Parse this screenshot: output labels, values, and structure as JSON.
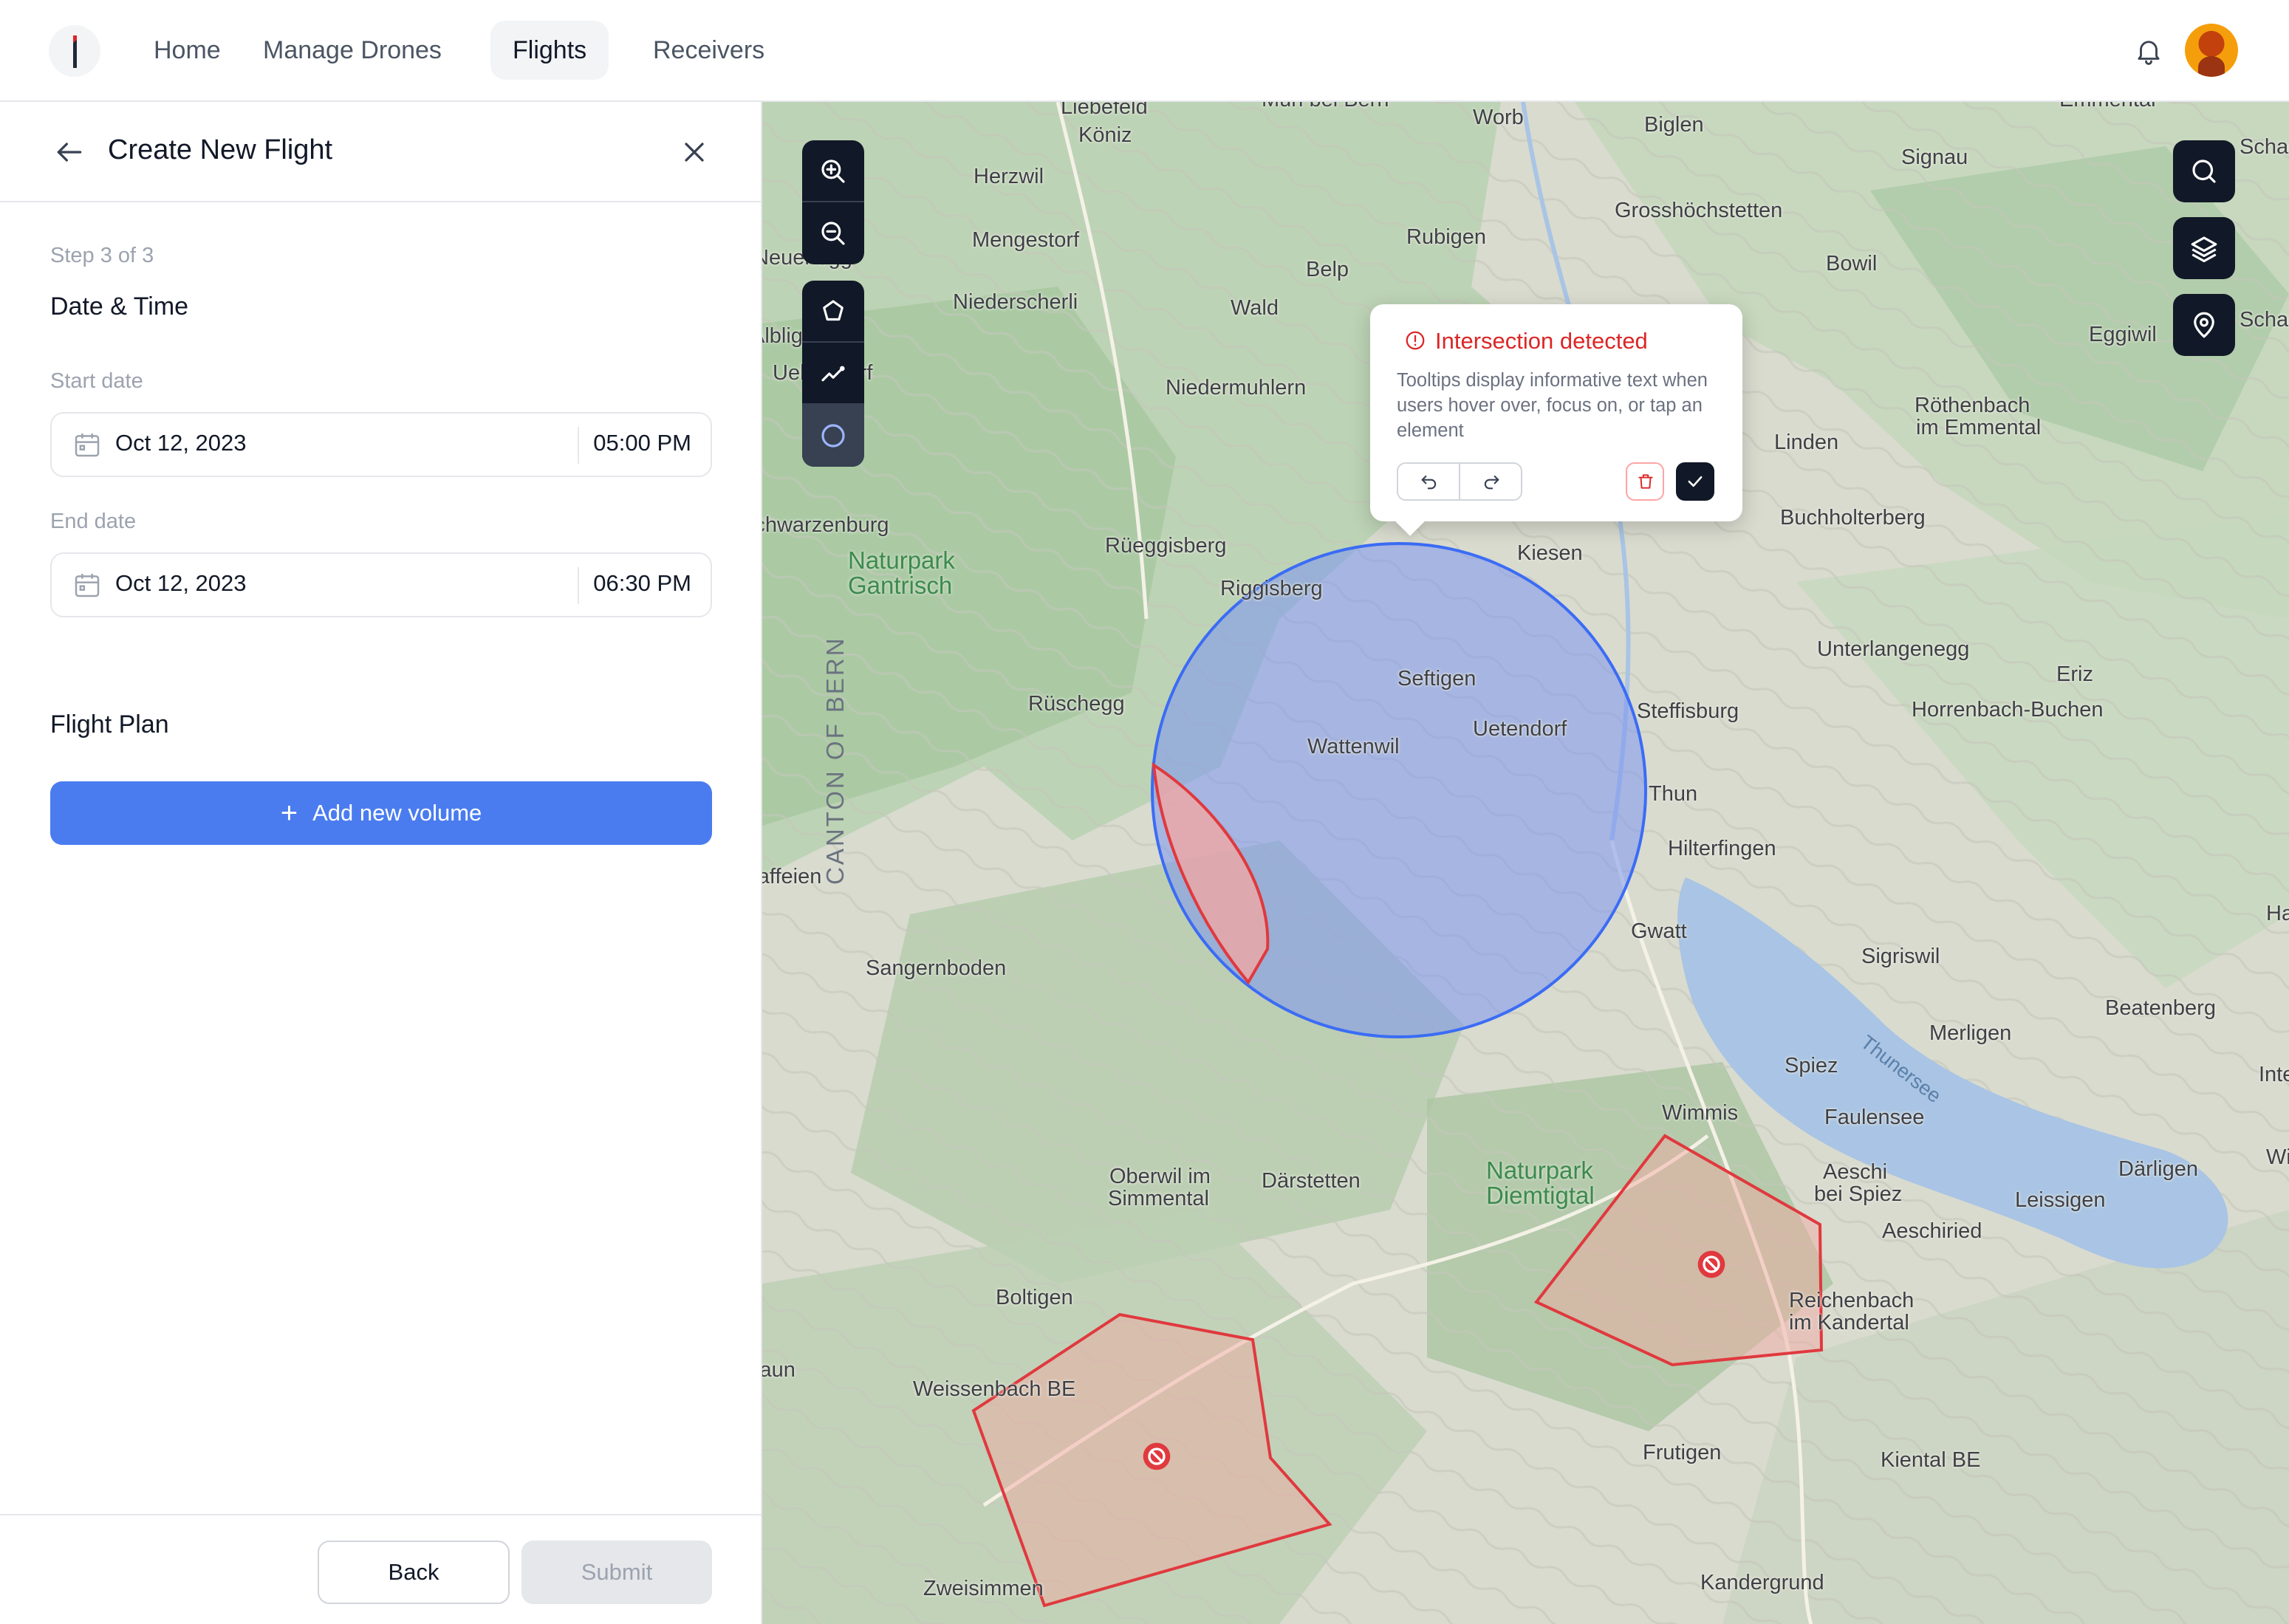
{
  "nav": {
    "items": [
      {
        "label": "Home",
        "active": false
      },
      {
        "label": "Manage Drones",
        "active": false
      },
      {
        "label": "Flights",
        "active": true
      },
      {
        "label": "Receivers",
        "active": false
      }
    ],
    "icons": [
      "app-logo-icon",
      "bell-icon",
      "user-avatar"
    ]
  },
  "panel": {
    "title": "Create New Flight",
    "step": "Step 3 of 3",
    "section_datetime": "Date & Time",
    "start_label": "Start date",
    "start_date": "Oct 12, 2023",
    "start_time": "05:00 PM",
    "end_label": "End date",
    "end_date": "Oct 12, 2023",
    "end_time": "06:30 PM",
    "section_plan": "Flight Plan",
    "add_volume": "Add new volume",
    "back": "Back",
    "submit": "Submit"
  },
  "map": {
    "canton": "CANTON OF BERN",
    "lake": "Thunersee",
    "parks": [
      {
        "line1": "Naturpark",
        "line2": "Gantrisch"
      },
      {
        "line1": "Naturpark",
        "line2": "Diemtigtal"
      }
    ],
    "places": [
      "Liebefeld",
      "Köniz",
      "Muri bei Bern",
      "Worb",
      "Biglen",
      "Emmental",
      "Signau",
      "Schachen",
      "Herzwil",
      "Mengestorf",
      "Rubigen",
      "Grosshöchstetten",
      "Bowil",
      "Neuenegg",
      "Belp",
      "Wald",
      "Niederscherli",
      "Eggiwil",
      "Schangnau",
      "Albligen",
      "Ueberstorf",
      "Niedermuhlern",
      "Röthenbach",
      "im Emmental",
      "Linden",
      "Schwarzenburg",
      "Buchholterberg",
      "Rüeggisberg",
      "Riggisberg",
      "Kiesen",
      "Seftigen",
      "Unterlangenegg",
      "Uetendorf",
      "Eriz",
      "Rüschegg",
      "Steffisburg",
      "Horrenbach-Buchen",
      "Wattenwil",
      "Thun",
      "Hilterfingen",
      "Plaffeien",
      "Gwatt",
      "Habkern",
      "Sigriswil",
      "Sangernboden",
      "Beatenberg",
      "Merligen",
      "Spiez",
      "Interlaken",
      "Wimmis",
      "Faulensee",
      "Oberwil im",
      "Simmental",
      "Därstetten",
      "Aeschi",
      "bei Spiez",
      "Därligen",
      "Wilderswil",
      "Leissigen",
      "Aeschiried",
      "Boltigen",
      "Reichenbach",
      "im Kandertal",
      "Jaun",
      "Weissenbach BE",
      "Frutigen",
      "Kiental BE",
      "Zweisimmen",
      "Kandergrund"
    ],
    "tooltip": {
      "title": "Intersection detected",
      "body": "Tooltips display informative text when users hover over, focus on, or tap an element"
    },
    "tools": [
      "zoom-in-icon",
      "zoom-out-icon",
      "polygon-tool-icon",
      "path-tool-icon",
      "circle-tool-icon",
      "search-icon",
      "layers-icon",
      "location-pin-icon"
    ],
    "colors": {
      "volume_fill": "#7b96f0",
      "volume_stroke": "#3b6cf5",
      "restricted_fill": "#f4a7a0",
      "restricted_stroke": "#e0393e",
      "lake": "#a9c4e4",
      "primary": "#4a7cf0"
    }
  }
}
